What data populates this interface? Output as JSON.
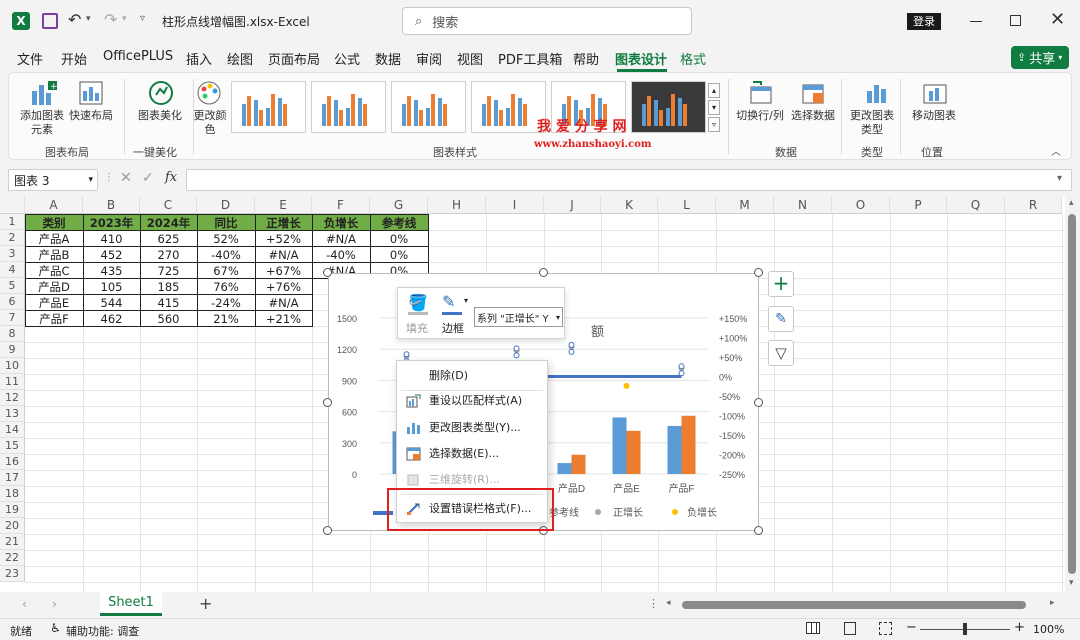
{
  "title_bar": {
    "filename": "柱形点线增幅图.xlsx",
    "sep": " - ",
    "app": "Excel",
    "search_placeholder": "搜索",
    "login_label": "登录"
  },
  "menu": [
    {
      "label": "文件"
    },
    {
      "label": "开始"
    },
    {
      "label": "OfficePLUS"
    },
    {
      "label": "插入"
    },
    {
      "label": "绘图"
    },
    {
      "label": "页面布局"
    },
    {
      "label": "公式"
    },
    {
      "label": "数据"
    },
    {
      "label": "审阅"
    },
    {
      "label": "视图"
    },
    {
      "label": "PDF工具箱"
    },
    {
      "label": "帮助"
    },
    {
      "label": "图表设计",
      "active": true
    },
    {
      "label": "格式",
      "accent": true
    }
  ],
  "share_label": "共享",
  "ribbon": {
    "add_element": "添加图表元素",
    "quick_layout": "快速布局",
    "beautify": "图表美化",
    "change_colors": "更改颜色",
    "switch_row_col": "切换行/列",
    "select_data": "选择数据",
    "change_type": "更改图表类型",
    "move_chart": "移动图表",
    "groups": {
      "layout": "图表布局",
      "one_click": "一键美化",
      "styles": "图表样式",
      "data": "数据",
      "type": "类型",
      "location": "位置"
    },
    "watermark_cn": "我 爱 分 享 网",
    "watermark_url": "www.zhanshaoyi.com"
  },
  "formula_bar": {
    "name_box": "图表 3",
    "fx": "fx"
  },
  "columns": [
    "A",
    "B",
    "C",
    "D",
    "E",
    "F",
    "G",
    "H",
    "I",
    "J",
    "K",
    "L",
    "M",
    "N",
    "O",
    "P",
    "Q",
    "R"
  ],
  "rows": [
    "1",
    "2",
    "3",
    "4",
    "5",
    "6",
    "7",
    "8",
    "9",
    "10",
    "11",
    "12",
    "13",
    "14",
    "15",
    "16",
    "17",
    "18",
    "19",
    "20",
    "21",
    "22",
    "23"
  ],
  "table": {
    "headers": [
      "类别",
      "2023年",
      "2024年",
      "同比",
      "正增长",
      "负增长",
      "参考线"
    ],
    "rows": [
      [
        "产品A",
        "410",
        "625",
        "52%",
        "+52%",
        "#N/A",
        "0%"
      ],
      [
        "产品B",
        "452",
        "270",
        "-40%",
        "#N/A",
        "-40%",
        "0%"
      ],
      [
        "产品C",
        "435",
        "725",
        "67%",
        "+67%",
        "#N/A",
        "0%"
      ],
      [
        "产品D",
        "105",
        "185",
        "76%",
        "+76%",
        "",
        ""
      ],
      [
        "产品E",
        "544",
        "415",
        "-24%",
        "#N/A",
        "",
        ""
      ],
      [
        "产品F",
        "462",
        "560",
        "21%",
        "+21%",
        "",
        ""
      ]
    ]
  },
  "chart_data": {
    "type": "bar",
    "categories": [
      "产品A",
      "产品B",
      "产品C",
      "产品D",
      "产品E",
      "产品F"
    ],
    "series": [
      {
        "name": "2023年",
        "values": [
          410,
          452,
          435,
          105,
          544,
          462
        ],
        "color": "#5b9bd5"
      },
      {
        "name": "2024年",
        "values": [
          625,
          270,
          725,
          185,
          415,
          560
        ],
        "color": "#ed7d31"
      }
    ],
    "line_series": [
      {
        "name": "参考线",
        "values": [
          0,
          0,
          0,
          0,
          0,
          0
        ],
        "color": "#4472c4"
      },
      {
        "name": "正增长",
        "values": [
          52,
          null,
          67,
          76,
          null,
          21
        ],
        "color": "#a5a5a5"
      },
      {
        "name": "负增长",
        "values": [
          null,
          -40,
          null,
          null,
          -24,
          null
        ],
        "color": "#ffc000"
      }
    ],
    "y_left": {
      "ticks": [
        "1500",
        "1200",
        "900",
        "600",
        "300",
        "0"
      ],
      "range": [
        0,
        1500
      ]
    },
    "y_right": {
      "ticks": [
        "+150%",
        "+100%",
        "+50%",
        "0%",
        "-50%",
        "-100%",
        "-150%",
        "-200%",
        "-250%"
      ],
      "range": [
        -250,
        150
      ]
    },
    "title_fragment": "额",
    "visible_categories": [
      "产品D",
      "产品E",
      "产品F"
    ],
    "legend_visible": [
      "参考线",
      "正增长",
      "负增长"
    ]
  },
  "mini_toolbar": {
    "fill": "填充",
    "border": "边框",
    "series_select": "系列 \"正增长\" Y"
  },
  "context_menu": [
    {
      "label": "删除(D)",
      "icon": "none",
      "enabled": true
    },
    {
      "label": "重设以匹配样式(A)",
      "icon": "reset-style-icon",
      "enabled": true
    },
    {
      "label": "更改图表类型(Y)...",
      "icon": "chart-type-icon",
      "enabled": true
    },
    {
      "label": "选择数据(E)...",
      "icon": "select-data-icon",
      "enabled": true
    },
    {
      "label": "三维旋转(R)...",
      "icon": "rotate-3d-icon",
      "enabled": false
    },
    {
      "label": "设置错误栏格式(F)...",
      "icon": "error-bar-icon",
      "enabled": true,
      "highlighted": true
    }
  ],
  "sheet_tab": "Sheet1",
  "status": {
    "ready": "就绪",
    "accessibility": "辅助功能: 调查",
    "zoom": "100%"
  },
  "colors": {
    "excel_green": "#217346",
    "tab_green": "#107c41",
    "highlight_red": "#e02020"
  }
}
